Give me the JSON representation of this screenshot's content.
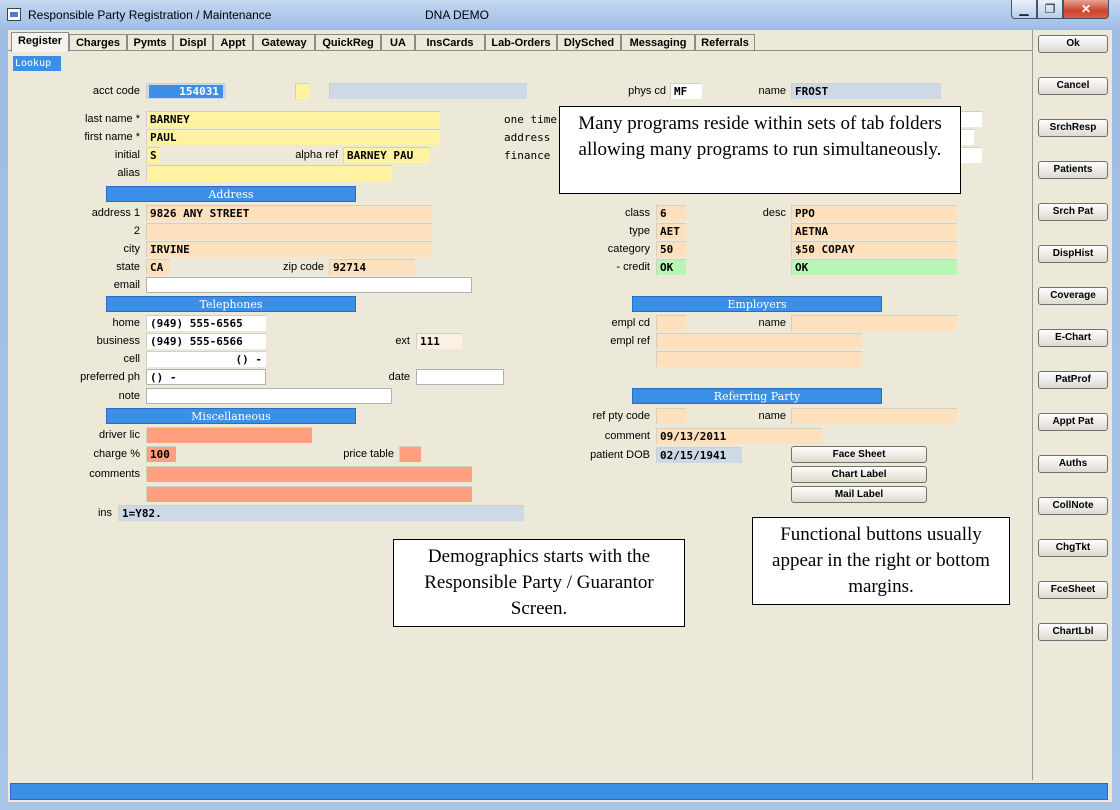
{
  "window": {
    "title": "Responsible Party Registration / Maintenance",
    "subtitle": "DNA DEMO",
    "min_glyph": "▁",
    "max_glyph": "❐",
    "close_glyph": "✕"
  },
  "tabs": [
    "Register",
    "Charges",
    "Pymts",
    "Displ",
    "Appt",
    "Gateway",
    "QuickReg",
    "UA",
    "InsCards",
    "Lab-Orders",
    "DlySched",
    "Messaging",
    "Referrals"
  ],
  "active_tab": "Register",
  "lookup_label": "Lookup",
  "account": {
    "acct_code_label": "acct code",
    "acct_code": "154031",
    "phys_cd_label": "phys cd",
    "phys_cd": "MF",
    "name_label": "name",
    "name": "FROST"
  },
  "patient": {
    "last_name_label": "last name *",
    "last_name": "BARNEY",
    "first_name_label": "first name *",
    "first_name": "PAUL",
    "initial_label": "initial",
    "initial": "S",
    "alpha_ref_label": "alpha ref",
    "alpha_ref": "BARNEY PAU",
    "alias_label": "alias",
    "alias": "",
    "one_time_label": "one time",
    "address_label": "address",
    "finance_label": "finance"
  },
  "address_section": {
    "title": "Address",
    "address1_label": "address 1",
    "address1": "9826 ANY STREET",
    "address2_label": "2",
    "address2": "",
    "city_label": "city",
    "city": "IRVINE",
    "state_label": "state",
    "state": "CA",
    "zip_label": "zip code",
    "zip": "92714",
    "email_label": "email",
    "email": ""
  },
  "class_section": {
    "class_label": "class",
    "class_value": "6",
    "desc_label": "desc",
    "desc_value": "PPO",
    "type_label": "type",
    "type_value": "AET",
    "type_desc": "AETNA",
    "category_label": "category",
    "category_value": "50",
    "category_desc": "$50 COPAY",
    "credit_label": "- credit",
    "credit_value": "OK",
    "credit_desc": "OK"
  },
  "telephones": {
    "title": "Telephones",
    "home_label": "home",
    "home": "(949) 555-6565",
    "business_label": "business",
    "business": "(949) 555-6566",
    "ext_label": "ext",
    "ext": "111",
    "cell_label": "cell",
    "cell": "() -",
    "preferred_label": "preferred ph",
    "preferred": "() -",
    "date_label": "date",
    "date": "",
    "note_label": "note",
    "note": ""
  },
  "employers": {
    "title": "Employers",
    "empl_cd_label": "empl cd",
    "empl_cd": "",
    "name_label": "name",
    "name": "",
    "empl_ref_label": "empl ref",
    "empl_ref": ""
  },
  "referring": {
    "title": "Referring Party",
    "ref_pty_code_label": "ref pty code",
    "ref_pty_code": "",
    "name_label": "name",
    "name": "",
    "comment_label": "comment",
    "comment": "09/13/2011",
    "dob_label": "patient DOB",
    "dob": "02/15/1941"
  },
  "misc": {
    "title": "Miscellaneous",
    "driver_lic_label": "driver lic",
    "driver_lic": "",
    "charge_label": "charge %",
    "charge": "100",
    "price_table_label": "price table",
    "price_table": "",
    "comments_label": "comments",
    "comments1": "",
    "comments2": "",
    "ins_label": "ins",
    "ins": "1=Y82."
  },
  "action_buttons": [
    "Face Sheet",
    "Chart Label",
    "Mail Label"
  ],
  "side_buttons": [
    "Ok",
    "Cancel",
    "SrchResp",
    "Patients",
    "Srch Pat",
    "DispHist",
    "Coverage",
    "E-Chart",
    "PatProf",
    "Appt Pat",
    "Auths",
    "CollNote",
    "ChgTkt",
    "FceSheet",
    "ChartLbl"
  ],
  "callouts": {
    "tabs_note": "Many programs reside within sets of tab folders allowing many programs to run simultaneously.",
    "demographics_note": "Demographics starts with the Responsible Party / Guarantor Screen.",
    "buttons_note": "Functional buttons usually appear in the right or bottom margins."
  },
  "colors": {
    "section_blue": "#3b8fe6",
    "field_yellow": "#fff2a3",
    "field_peach": "#ffe0bd",
    "field_salmon": "#ff9f7f",
    "field_green": "#b7f7b5",
    "field_gray_blue": "#cdd9e6"
  }
}
